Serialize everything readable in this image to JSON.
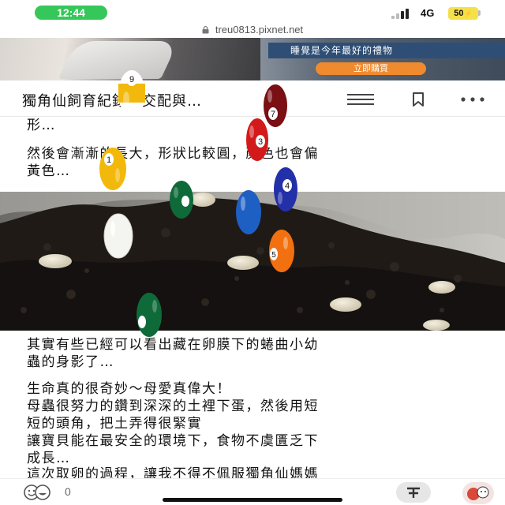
{
  "status_bar": {
    "time": "12:44",
    "network": "4G",
    "battery": "50"
  },
  "url_bar": {
    "url": "treu0813.pixnet.net",
    "icon": "lock-icon"
  },
  "ad": {
    "title": "睡覺是今年最好的禮物",
    "cta": "立即購買"
  },
  "header": {
    "title": "獨角仙飼育紀錄…交配與…",
    "menu_icon": "hamburger-menu-icon",
    "bookmark_icon": "bookmark-icon",
    "more_icon": "more-dots-icon"
  },
  "article": {
    "p1": "形…",
    "p2": "然後會漸漸的長大，形狀比較圓，顏色也會偏\n黃色…",
    "p3": "其實有些已經可以看出藏在卵膜下的蜷曲小幼\n蟲的身影了…",
    "p4": "生命真的很奇妙～母愛真偉大！\n母蟲很努力的鑽到深深的土裡下蛋，然後用短\n短的頭角，把土弄得很緊實\n讓寶貝能在最安全的環境下，食物不虞匱乏下\n成長…",
    "p5": "這次取卵的過程，讓我不得不佩服獨角仙媽媽"
  },
  "bottom_bar": {
    "like_count": "0",
    "like_icon": "like-reaction-icon",
    "tip_icon": "tip-icon",
    "avatar": "user-avatar"
  },
  "overlay": {
    "balls": [
      {
        "number": "9",
        "color": "#f2b90c",
        "stripe": true
      },
      {
        "number": "7",
        "color": "#7a0f14",
        "stripe": false
      },
      {
        "number": "3",
        "color": "#d31a1a",
        "stripe": false
      },
      {
        "number": "1",
        "color": "#f2b90c",
        "stripe": false
      },
      {
        "number": "4",
        "color": "#2430a8",
        "stripe": false
      },
      {
        "number": "",
        "color": "#0f6a3a",
        "stripe": false
      },
      {
        "number": "",
        "color": "#1e5fc4",
        "stripe": false
      },
      {
        "number": "",
        "color": "#f4f4f0",
        "stripe": false
      },
      {
        "number": "5",
        "color": "#f2700f",
        "stripe": false
      },
      {
        "number": "",
        "color": "#0f6a3a",
        "stripe": false
      }
    ]
  },
  "colors": {
    "time_pill": "#35c759",
    "battery": "#f5e04a",
    "ad_title_bg": "#2e4e75",
    "ad_cta_bg": "#f08a2e"
  }
}
